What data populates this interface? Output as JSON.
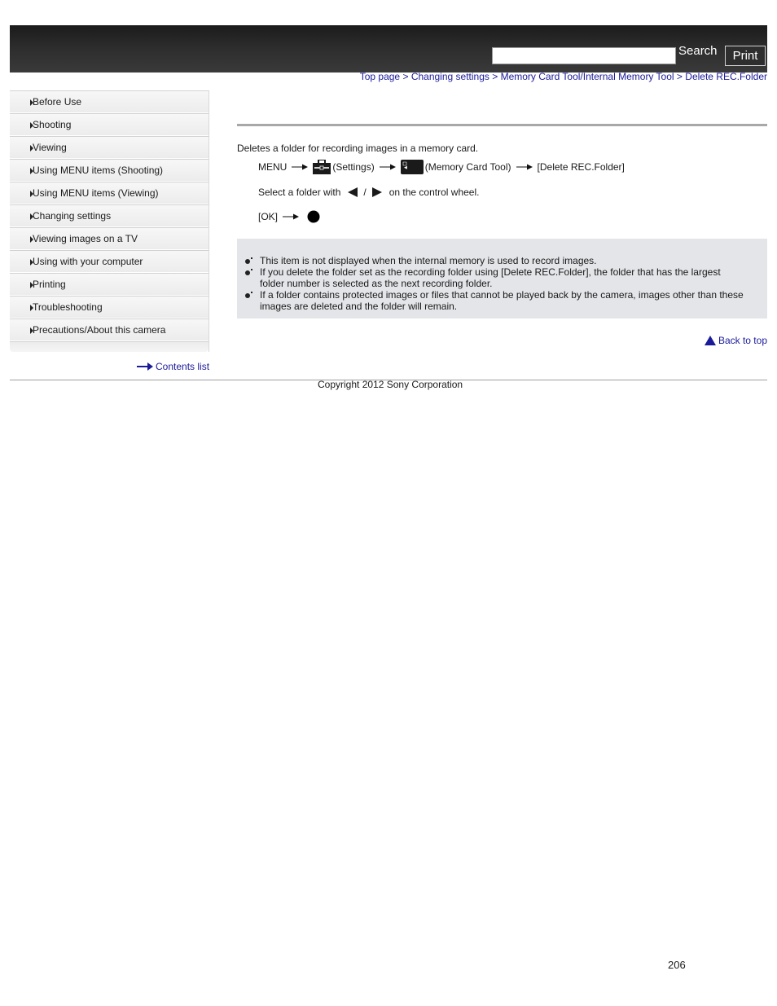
{
  "header": {
    "search_value": "",
    "search_label": "Search",
    "print_label": "Print"
  },
  "breadcrumb": [
    "Top page",
    "Changing settings",
    "Memory Card Tool/Internal Memory Tool",
    "Delete REC.Folder"
  ],
  "breadcrumb_sep": ">",
  "sidebar": {
    "items": [
      {
        "label": "Before Use"
      },
      {
        "label": "Shooting"
      },
      {
        "label": "Viewing"
      },
      {
        "label": "Using MENU items (Shooting)"
      },
      {
        "label": "Using MENU items (Viewing)"
      },
      {
        "label": "Changing settings"
      },
      {
        "label": "Viewing images on a TV"
      },
      {
        "label": "Using with your computer"
      },
      {
        "label": "Printing"
      },
      {
        "label": "Troubleshooting"
      },
      {
        "label": "Precautions/About this camera"
      }
    ],
    "contents_link": "Contents list"
  },
  "main": {
    "description": "Deletes a folder for recording images in a memory card.",
    "step1": {
      "menu": "MENU",
      "settings": "(Settings)",
      "memory_card_tool": "(Memory Card Tool)",
      "delete": "[Delete REC.Folder]"
    },
    "step2": {
      "prefix": "Select a folder with",
      "slash": "/",
      "suffix": "on the control wheel."
    },
    "step3": {
      "ok": "[OK]"
    },
    "notes": [
      "This item is not displayed when the internal memory is used to record images.",
      "If you delete the folder set as the recording folder using [Delete REC.Folder], the folder that has the largest folder number is selected as the next recording folder.",
      "If a folder contains protected images or files that cannot be played back by the camera, images other than these images are deleted and the folder will remain."
    ],
    "back_to_top": "Back to top"
  },
  "footer": {
    "copyright": "Copyright 2012 Sony Corporation",
    "page_number": "206"
  },
  "colors": {
    "link": "#1b1b9a",
    "header_bg": "#2a2a2a",
    "note_bg": "#e3e5e8"
  }
}
